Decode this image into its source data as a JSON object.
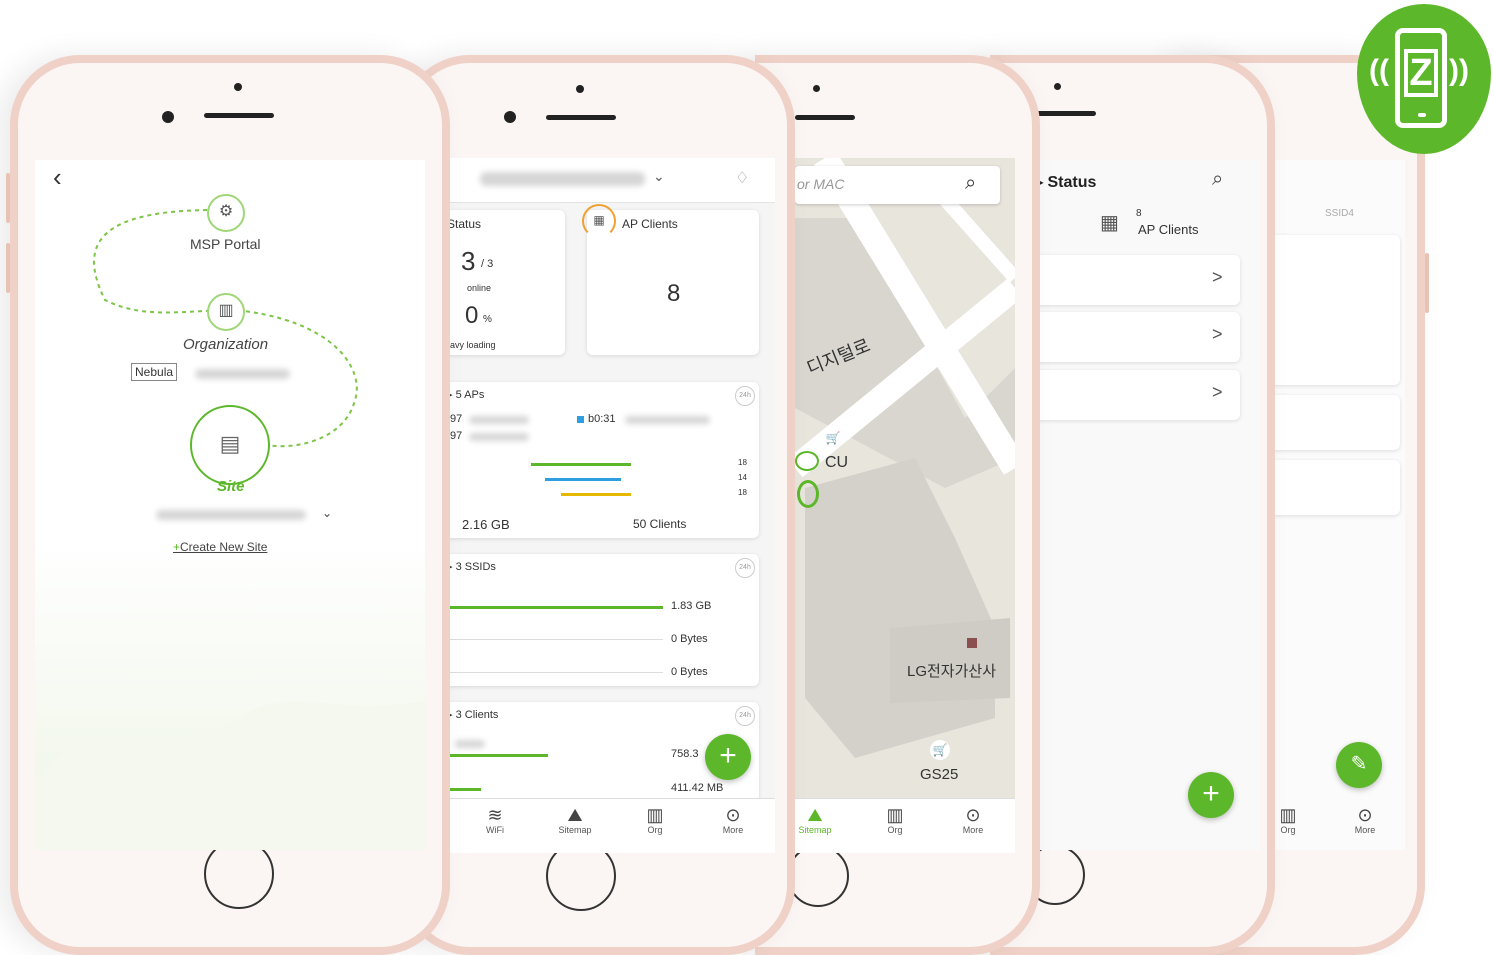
{
  "badge": {
    "letter": "Z",
    "color": "#5cb82a"
  },
  "phone1": {
    "msp_portal": "MSP Portal",
    "organization": "Organization",
    "org_tag": "Nebula",
    "site": "Site",
    "create_site": "Create New Site",
    "create_plus": "+"
  },
  "phone2": {
    "status_title": "Status",
    "ap_count": "3",
    "ap_total": "/ 3",
    "online": "online",
    "load_value": "0",
    "load_unit": "%",
    "heavy_loading": "eavy loading",
    "ap_clients_title": "AP Clients",
    "ap_clients_value": "8",
    "top_aps_title": "5 APs",
    "ap_mac1": ":97",
    "ap_mac2": ":97",
    "ap_mac3": "b0:31",
    "y_ticks": [
      "18",
      "14",
      "18"
    ],
    "usage_total": "2.16 GB",
    "clients_total": "50 Clients",
    "ssids_title": "3 SSIDs",
    "ssid_values": [
      "1.83 GB",
      "0 Bytes",
      "0 Bytes"
    ],
    "clients_title": "3 Clients",
    "client_values": [
      "758.3",
      "411.42 MB"
    ],
    "badge_24": "24h",
    "tabs": [
      "WiFi",
      "Sitemap",
      "Org",
      "More"
    ]
  },
  "phone3": {
    "search_placeholder": "or MAC",
    "street_label": "디지털로",
    "poi_cu": "CU",
    "poi_lg": "LG전자가산사",
    "poi_gs": "GS25",
    "tabs": [
      "Sitemap",
      "Org",
      "More"
    ]
  },
  "phone4": {
    "title": "Status",
    "clients_count": "8",
    "clients_label": "AP Clients",
    "rows": [
      ">",
      ">",
      ">"
    ]
  },
  "phone5": {
    "column_header": "SSID4",
    "tabs": [
      "Org",
      "More"
    ]
  }
}
